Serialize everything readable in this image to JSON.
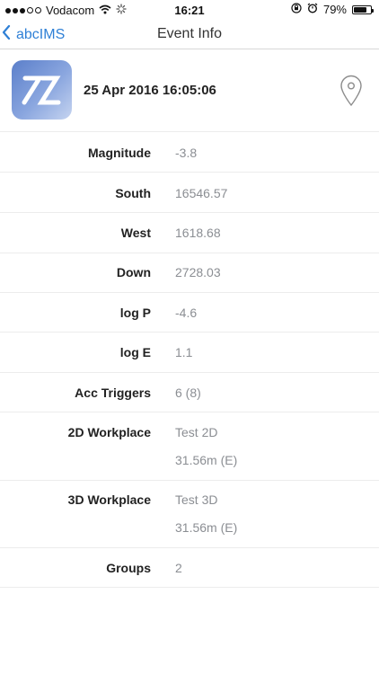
{
  "status_bar": {
    "carrier": "Vodacom",
    "time": "16:21",
    "battery_percent_label": "79%",
    "battery_level": 0.79
  },
  "nav": {
    "back_label": "abcIMS",
    "title": "Event Info"
  },
  "event": {
    "datetime": "25 Apr 2016 16:05:06"
  },
  "fields": [
    {
      "label": "Magnitude",
      "value": "-3.8"
    },
    {
      "label": "South",
      "value": "16546.57"
    },
    {
      "label": "West",
      "value": "1618.68"
    },
    {
      "label": "Down",
      "value": "2728.03"
    },
    {
      "label": "log P",
      "value": "-4.6"
    },
    {
      "label": "log E",
      "value": "1.1"
    },
    {
      "label": "Acc Triggers",
      "value": "6 (8)"
    },
    {
      "label": "2D Workplace",
      "value": "Test 2D",
      "value2": "31.56m (E)"
    },
    {
      "label": "3D Workplace",
      "value": "Test 3D",
      "value2": "31.56m (E)"
    },
    {
      "label": "Groups",
      "value": "2"
    }
  ],
  "colors": {
    "accent": "#2f80d6",
    "logo_gradient": [
      "#5b7fca",
      "#c6d4f0"
    ]
  },
  "icons": [
    "wifi-icon",
    "activity-spinner-icon",
    "orientation-lock-icon",
    "alarm-icon",
    "battery-icon",
    "chevron-left-icon",
    "location-pin-icon"
  ]
}
